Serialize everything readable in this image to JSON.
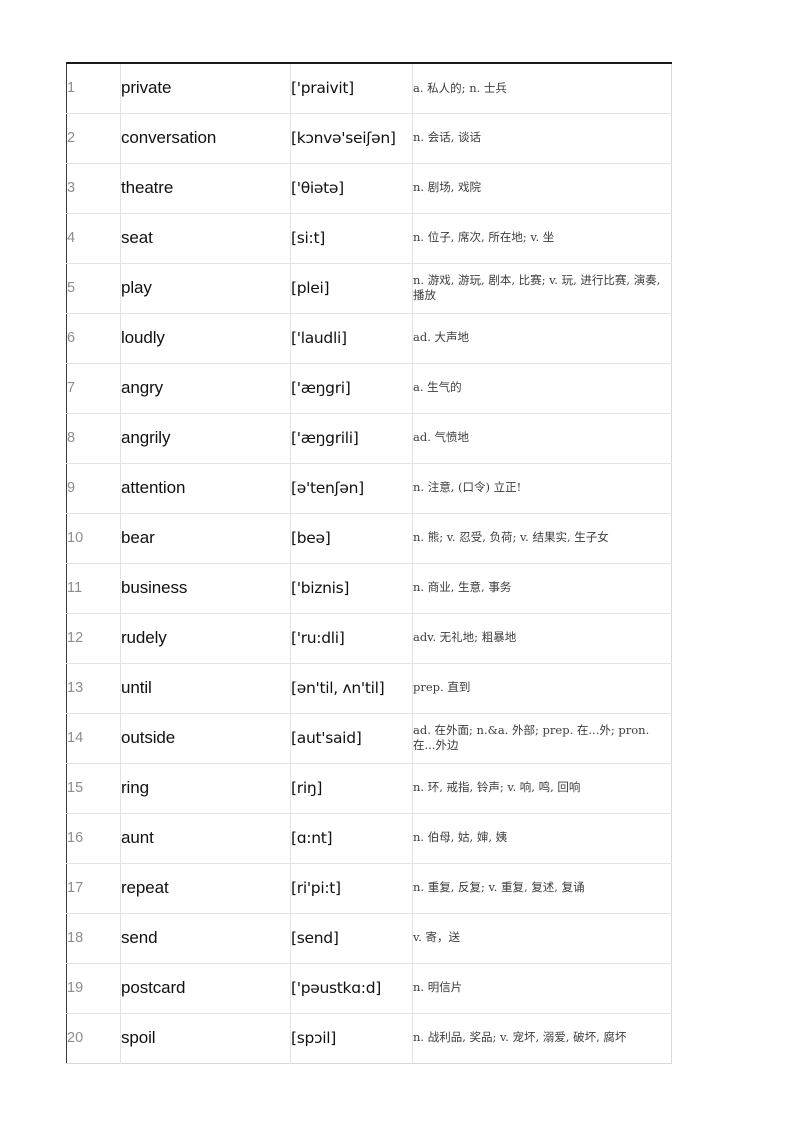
{
  "document": {
    "type": "vocabulary-table",
    "columns": [
      "index",
      "word",
      "phonetic",
      "definition"
    ],
    "row_count": 20
  },
  "rows": [
    {
      "index": "1",
      "word": "private",
      "ipa": "['praivit]",
      "definition": "a.  私人的; n.  士兵"
    },
    {
      "index": "2",
      "word": "conversation",
      "ipa": "[kɔnvə'seiʃən]",
      "definition": "n.  会话, 谈话"
    },
    {
      "index": "3",
      "word": "theatre",
      "ipa": "['θiətə]",
      "definition": "n.  剧场, 戏院"
    },
    {
      "index": "4",
      "word": "seat",
      "ipa": "[si:t]",
      "definition": "n.  位子, 席次, 所在地; v.  坐"
    },
    {
      "index": "5",
      "word": "play",
      "ipa": "[plei]",
      "definition": "n.  游戏, 游玩, 剧本, 比赛; v.  玩, 进行比赛, 演奏, 播放"
    },
    {
      "index": "6",
      "word": "loudly",
      "ipa": "['laudli]",
      "definition": "ad. 大声地"
    },
    {
      "index": "7",
      "word": "angry",
      "ipa": "['æŋgri]",
      "definition": "a.  生气的"
    },
    {
      "index": "8",
      "word": "angrily",
      "ipa": "['æŋgrili]",
      "definition": "ad.  气愤地"
    },
    {
      "index": "9",
      "word": "attention",
      "ipa": "[ə'tenʃən]",
      "definition": "n.  注意, (口令) 立正!"
    },
    {
      "index": "10",
      "word": "bear",
      "ipa": "[beə]",
      "definition": "n.  熊; v.  忍受, 负荷; v.  结果实, 生子女"
    },
    {
      "index": "11",
      "word": "business",
      "ipa": "['biznis]",
      "definition": "n.  商业, 生意, 事务"
    },
    {
      "index": "12",
      "word": "rudely",
      "ipa": "['ru:dli]",
      "definition": "adv.  无礼地; 粗暴地"
    },
    {
      "index": "13",
      "word": "until",
      "ipa": "[ən'til, ʌn'til]",
      "definition": "prep. 直到"
    },
    {
      "index": "14",
      "word": "outside",
      "ipa": "[aut'said]",
      "definition": "ad.  在外面; n.&a.  外部; prep. 在...外; pron.  在...外边"
    },
    {
      "index": "15",
      "word": "ring",
      "ipa": "[riŋ]",
      "definition": "n.  环, 戒指, 铃声; v.  响, 鸣, 回响"
    },
    {
      "index": "16",
      "word": "aunt",
      "ipa": "[ɑ:nt]",
      "definition": "n.  伯母, 姑, 婶, 姨"
    },
    {
      "index": "17",
      "word": "repeat",
      "ipa": "[ri'pi:t]",
      "definition": "n.  重复, 反复; v.  重复, 复述, 复诵"
    },
    {
      "index": "18",
      "word": "send",
      "ipa": "[send]",
      "definition": "v. 寄，送"
    },
    {
      "index": "19",
      "word": "postcard",
      "ipa": "['pəustkɑ:d]",
      "definition": "n.  明信片"
    },
    {
      "index": "20",
      "word": "spoil",
      "ipa": "[spɔil]",
      "definition": "n.  战利品, 奖品; v.  宠坏, 溺爱, 破坏, 腐坏"
    }
  ],
  "colors": {
    "page_background": "#ffffff",
    "outer_border": "#1a1a1a",
    "grid_line": "#e3e3e3",
    "index_text": "#8d8d8d",
    "word_text": "#111111",
    "definition_text": "#3c3c3c"
  }
}
